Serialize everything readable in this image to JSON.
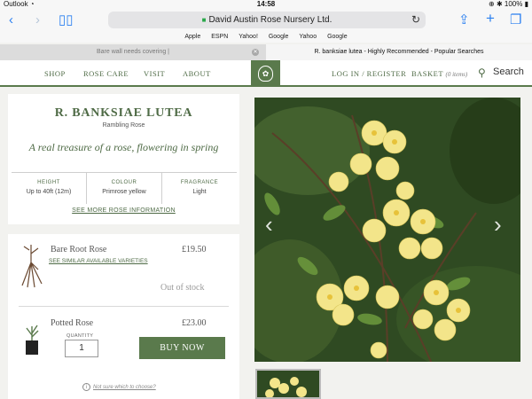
{
  "status": {
    "carrier": "Outlook",
    "time": "14:58",
    "battery": "100%"
  },
  "browser": {
    "url": "David Austin Rose Nursery Ltd.",
    "bookmarks": [
      "Apple",
      "ESPN",
      "Yahoo!",
      "Google",
      "Yahoo",
      "Google"
    ],
    "tabs": [
      {
        "label": "Bare wall needs covering |"
      },
      {
        "label": "R. banksiae lutea - Highly Recommended - Popular Searches"
      }
    ]
  },
  "nav": {
    "shop": "SHOP",
    "rose_care": "ROSE CARE",
    "visit": "VISIT",
    "about": "ABOUT",
    "login": "LOG IN / REGISTER",
    "basket": "BASKET",
    "basket_count": "(0 items)",
    "search": "Search"
  },
  "product": {
    "title": "R. BANKSIAE LUTEA",
    "type": "Rambling Rose",
    "tagline": "A real treasure of a rose, flowering in spring",
    "attributes": [
      {
        "label": "HEIGHT",
        "value": "Up to 40ft (12m)"
      },
      {
        "label": "COLOUR",
        "value": "Primrose yellow"
      },
      {
        "label": "FRAGRANCE",
        "value": "Light"
      }
    ],
    "more_link": "SEE MORE ROSE INFORMATION"
  },
  "purchase": {
    "bare_root": {
      "name": "Bare Root Rose",
      "price": "£19.50",
      "similar_link": "SEE SIMILAR AVAILABLE VARIETIES",
      "status": "Out of stock"
    },
    "potted": {
      "name": "Potted Rose",
      "price": "£23.00",
      "quantity_label": "QUANTITY",
      "quantity": "1",
      "buy_label": "BUY NOW"
    },
    "help_link": "Not sure which to choose?"
  },
  "gallery": {
    "prev_icon": "‹",
    "next_icon": "›"
  },
  "colors": {
    "brand_green": "#5a7a4c",
    "link_blue": "#2a7ff0"
  }
}
